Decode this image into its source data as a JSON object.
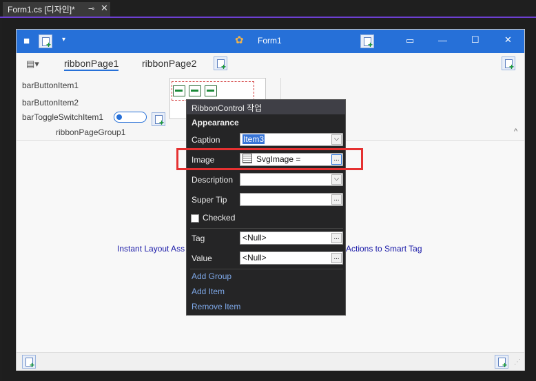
{
  "document_tab": {
    "title": "Form1.cs [디자인]*",
    "pin_icon": "⊸",
    "close_icon": "✕"
  },
  "form": {
    "title": "Form1",
    "window_controls": {
      "restore": "▭",
      "minimize": "—",
      "maximize": "☐",
      "close": "✕"
    },
    "quick_access_dropdown": "▾"
  },
  "ribbon": {
    "tabs": [
      "ribbonPage1",
      "ribbonPage2"
    ],
    "items": [
      "barButtonItem1",
      "barButtonItem2",
      "barToggleSwitchItem1"
    ],
    "group_label": "ribbonPageGroup1",
    "collapse_icon": "^"
  },
  "background_text": {
    "left": "Instant Layout Ass",
    "right": "Actions to Smart Tag"
  },
  "smart_tag": {
    "header": "RibbonControl 작업",
    "section": "Appearance",
    "fields": [
      {
        "label": "Caption",
        "value": "Item3"
      },
      {
        "label": "Image",
        "value": "SvgImage ="
      },
      {
        "label": "Description",
        "value": ""
      },
      {
        "label": "Super Tip",
        "value": ""
      }
    ],
    "checked_label": "Checked",
    "tag": {
      "label": "Tag",
      "value": "<Null>"
    },
    "value": {
      "label": "Value",
      "value": "<Null>"
    },
    "actions": [
      "Add Group",
      "Add Item",
      "Remove Item"
    ],
    "ellipsis": "...",
    "dropdown": "⌵"
  },
  "colors": {
    "accent": "#2670d8",
    "highlight": "#e53131",
    "tab_underline": "#6c3fd1"
  }
}
